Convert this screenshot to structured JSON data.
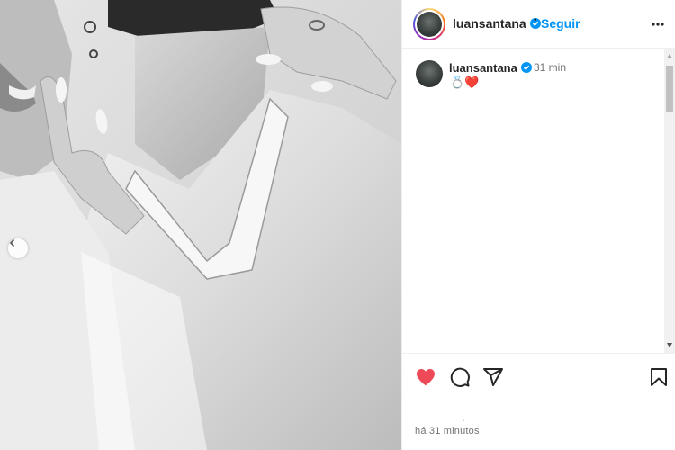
{
  "post": {
    "username": "luansantana",
    "follow_label": "Seguir",
    "dot_separator": "•",
    "caption": {
      "username": "luansantana",
      "time": "31 min",
      "text": "💍❤️"
    },
    "timestamp": "há 31 minutos",
    "likes_placeholder": "."
  },
  "icons": {
    "verified": "verified-badge-icon",
    "more": "more-options-icon",
    "like": "heart-filled-icon",
    "comment": "comment-icon",
    "share": "share-icon",
    "save": "bookmark-icon",
    "prev": "chevron-left-icon"
  },
  "colors": {
    "accent": "#0095f6",
    "verified": "#0095f6",
    "like": "#ed4956"
  }
}
